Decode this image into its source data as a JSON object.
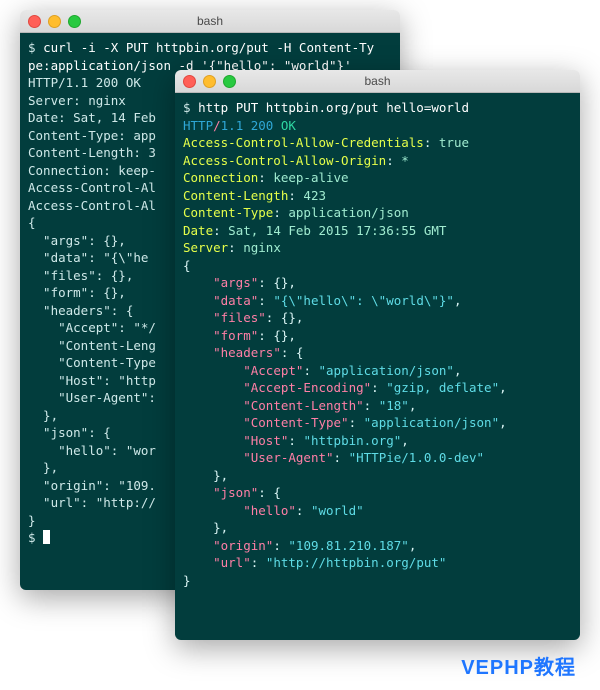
{
  "win1": {
    "title": "bash",
    "lines": [
      [
        {
          "cls": "prompt",
          "t": "$ "
        },
        {
          "cls": "cmd",
          "t": "curl -i -X PUT httpbin.org/put -H Content-Ty"
        }
      ],
      [
        {
          "cls": "cmd",
          "t": "pe:application/json -d '{\"hello\": \"world\"}'"
        }
      ],
      [
        {
          "cls": "plain",
          "t": "HTTP/1.1 200 OK"
        }
      ],
      [
        {
          "cls": "plain",
          "t": "Server: nginx"
        }
      ],
      [
        {
          "cls": "plain",
          "t": "Date: Sat, 14 Feb"
        }
      ],
      [
        {
          "cls": "plain",
          "t": "Content-Type: app"
        }
      ],
      [
        {
          "cls": "plain",
          "t": "Content-Length: 3"
        }
      ],
      [
        {
          "cls": "plain",
          "t": "Connection: keep-"
        }
      ],
      [
        {
          "cls": "plain",
          "t": "Access-Control-Al"
        }
      ],
      [
        {
          "cls": "plain",
          "t": "Access-Control-Al"
        }
      ],
      [
        {
          "cls": "plain",
          "t": ""
        }
      ],
      [
        {
          "cls": "plain",
          "t": "{"
        }
      ],
      [
        {
          "cls": "plain",
          "t": "  \"args\": {},"
        }
      ],
      [
        {
          "cls": "plain",
          "t": "  \"data\": \"{\\\"he"
        }
      ],
      [
        {
          "cls": "plain",
          "t": "  \"files\": {},"
        }
      ],
      [
        {
          "cls": "plain",
          "t": "  \"form\": {},"
        }
      ],
      [
        {
          "cls": "plain",
          "t": "  \"headers\": {"
        }
      ],
      [
        {
          "cls": "plain",
          "t": "    \"Accept\": \"*/"
        }
      ],
      [
        {
          "cls": "plain",
          "t": "    \"Content-Leng"
        }
      ],
      [
        {
          "cls": "plain",
          "t": "    \"Content-Type"
        }
      ],
      [
        {
          "cls": "plain",
          "t": "    \"Host\": \"http"
        }
      ],
      [
        {
          "cls": "plain",
          "t": "    \"User-Agent\":"
        }
      ],
      [
        {
          "cls": "plain",
          "t": "  },"
        }
      ],
      [
        {
          "cls": "plain",
          "t": "  \"json\": {"
        }
      ],
      [
        {
          "cls": "plain",
          "t": "    \"hello\": \"wor"
        }
      ],
      [
        {
          "cls": "plain",
          "t": "  },"
        }
      ],
      [
        {
          "cls": "plain",
          "t": "  \"origin\": \"109."
        }
      ],
      [
        {
          "cls": "plain",
          "t": "  \"url\": \"http://"
        }
      ],
      [
        {
          "cls": "plain",
          "t": "}"
        }
      ],
      [
        {
          "cls": "prompt",
          "t": "$ "
        },
        {
          "cls": "cursor",
          "t": ""
        }
      ]
    ]
  },
  "win2": {
    "title": "bash",
    "lines": [
      [
        {
          "cls": "prompt",
          "t": "$ "
        },
        {
          "cls": "cmd",
          "t": "http PUT httpbin.org/put hello=world"
        }
      ],
      [
        {
          "cls": "proto",
          "t": "HTTP"
        },
        {
          "cls": "slash",
          "t": "/"
        },
        {
          "cls": "ver",
          "t": "1.1"
        },
        {
          "cls": "plain",
          "t": " "
        },
        {
          "cls": "st200",
          "t": "200"
        },
        {
          "cls": "plain",
          "t": " "
        },
        {
          "cls": "ok",
          "t": "OK"
        }
      ],
      [
        {
          "cls": "hname",
          "t": "Access-Control-Allow-Credentials"
        },
        {
          "cls": "punc",
          "t": ": "
        },
        {
          "cls": "hval",
          "t": "true"
        }
      ],
      [
        {
          "cls": "hname",
          "t": "Access-Control-Allow-Origin"
        },
        {
          "cls": "punc",
          "t": ": "
        },
        {
          "cls": "hval",
          "t": "*"
        }
      ],
      [
        {
          "cls": "hname",
          "t": "Connection"
        },
        {
          "cls": "punc",
          "t": ": "
        },
        {
          "cls": "hval",
          "t": "keep-alive"
        }
      ],
      [
        {
          "cls": "hname",
          "t": "Content-Length"
        },
        {
          "cls": "punc",
          "t": ": "
        },
        {
          "cls": "hval",
          "t": "423"
        }
      ],
      [
        {
          "cls": "hname",
          "t": "Content-Type"
        },
        {
          "cls": "punc",
          "t": ": "
        },
        {
          "cls": "hval",
          "t": "application/json"
        }
      ],
      [
        {
          "cls": "hname",
          "t": "Date"
        },
        {
          "cls": "punc",
          "t": ": "
        },
        {
          "cls": "hval",
          "t": "Sat, 14 Feb 2015 17:36:55 GMT"
        }
      ],
      [
        {
          "cls": "hname",
          "t": "Server"
        },
        {
          "cls": "punc",
          "t": ": "
        },
        {
          "cls": "hval",
          "t": "nginx"
        }
      ],
      [
        {
          "cls": "plain",
          "t": ""
        }
      ],
      [
        {
          "cls": "punc",
          "t": "{"
        }
      ],
      [
        {
          "cls": "punc",
          "t": "    "
        },
        {
          "cls": "key",
          "t": "\"args\""
        },
        {
          "cls": "punc",
          "t": ": {},"
        }
      ],
      [
        {
          "cls": "punc",
          "t": "    "
        },
        {
          "cls": "key",
          "t": "\"data\""
        },
        {
          "cls": "punc",
          "t": ": "
        },
        {
          "cls": "str",
          "t": "\"{\\\"hello\\\": \\\"world\\\"}\""
        },
        {
          "cls": "punc",
          "t": ","
        }
      ],
      [
        {
          "cls": "punc",
          "t": "    "
        },
        {
          "cls": "key",
          "t": "\"files\""
        },
        {
          "cls": "punc",
          "t": ": {},"
        }
      ],
      [
        {
          "cls": "punc",
          "t": "    "
        },
        {
          "cls": "key",
          "t": "\"form\""
        },
        {
          "cls": "punc",
          "t": ": {},"
        }
      ],
      [
        {
          "cls": "punc",
          "t": "    "
        },
        {
          "cls": "key",
          "t": "\"headers\""
        },
        {
          "cls": "punc",
          "t": ": {"
        }
      ],
      [
        {
          "cls": "punc",
          "t": "        "
        },
        {
          "cls": "key",
          "t": "\"Accept\""
        },
        {
          "cls": "punc",
          "t": ": "
        },
        {
          "cls": "str",
          "t": "\"application/json\""
        },
        {
          "cls": "punc",
          "t": ","
        }
      ],
      [
        {
          "cls": "punc",
          "t": "        "
        },
        {
          "cls": "key",
          "t": "\"Accept-Encoding\""
        },
        {
          "cls": "punc",
          "t": ": "
        },
        {
          "cls": "str",
          "t": "\"gzip, deflate\""
        },
        {
          "cls": "punc",
          "t": ","
        }
      ],
      [
        {
          "cls": "punc",
          "t": "        "
        },
        {
          "cls": "key",
          "t": "\"Content-Length\""
        },
        {
          "cls": "punc",
          "t": ": "
        },
        {
          "cls": "str",
          "t": "\"18\""
        },
        {
          "cls": "punc",
          "t": ","
        }
      ],
      [
        {
          "cls": "punc",
          "t": "        "
        },
        {
          "cls": "key",
          "t": "\"Content-Type\""
        },
        {
          "cls": "punc",
          "t": ": "
        },
        {
          "cls": "str",
          "t": "\"application/json\""
        },
        {
          "cls": "punc",
          "t": ","
        }
      ],
      [
        {
          "cls": "punc",
          "t": "        "
        },
        {
          "cls": "key",
          "t": "\"Host\""
        },
        {
          "cls": "punc",
          "t": ": "
        },
        {
          "cls": "str",
          "t": "\"httpbin.org\""
        },
        {
          "cls": "punc",
          "t": ","
        }
      ],
      [
        {
          "cls": "punc",
          "t": "        "
        },
        {
          "cls": "key",
          "t": "\"User-Agent\""
        },
        {
          "cls": "punc",
          "t": ": "
        },
        {
          "cls": "str",
          "t": "\"HTTPie/1.0.0-dev\""
        }
      ],
      [
        {
          "cls": "punc",
          "t": "    },"
        }
      ],
      [
        {
          "cls": "punc",
          "t": "    "
        },
        {
          "cls": "key",
          "t": "\"json\""
        },
        {
          "cls": "punc",
          "t": ": {"
        }
      ],
      [
        {
          "cls": "punc",
          "t": "        "
        },
        {
          "cls": "key",
          "t": "\"hello\""
        },
        {
          "cls": "punc",
          "t": ": "
        },
        {
          "cls": "str",
          "t": "\"world\""
        }
      ],
      [
        {
          "cls": "punc",
          "t": "    },"
        }
      ],
      [
        {
          "cls": "punc",
          "t": "    "
        },
        {
          "cls": "key",
          "t": "\"origin\""
        },
        {
          "cls": "punc",
          "t": ": "
        },
        {
          "cls": "str",
          "t": "\"109.81.210.187\""
        },
        {
          "cls": "punc",
          "t": ","
        }
      ],
      [
        {
          "cls": "punc",
          "t": "    "
        },
        {
          "cls": "key",
          "t": "\"url\""
        },
        {
          "cls": "punc",
          "t": ": "
        },
        {
          "cls": "str",
          "t": "\"http://httpbin.org/put\""
        }
      ],
      [
        {
          "cls": "punc",
          "t": "}"
        }
      ]
    ]
  },
  "footer": "VEPHP教程"
}
